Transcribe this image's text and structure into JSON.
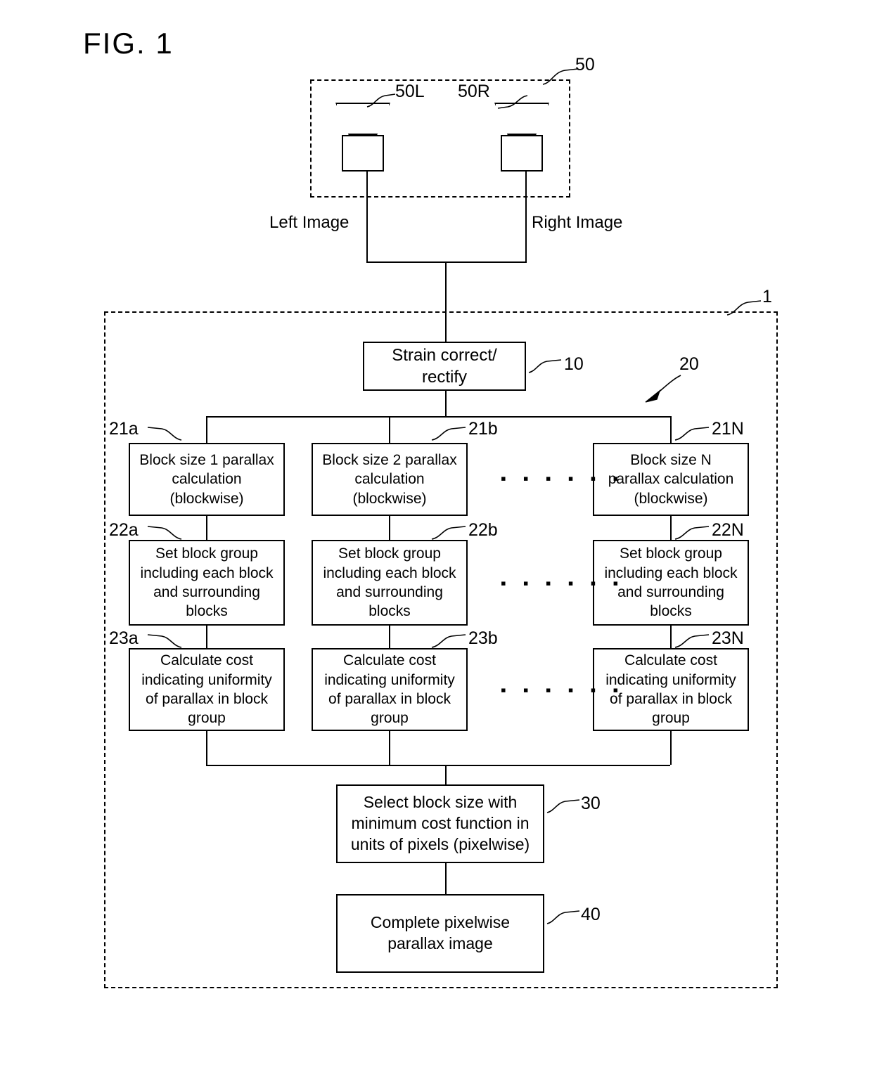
{
  "figure": {
    "title": "FIG. 1"
  },
  "camera_unit": {
    "ref": "50",
    "left_camera": {
      "ref": "50L",
      "icon": "camera-icon"
    },
    "right_camera": {
      "ref": "50R",
      "icon": "camera-icon"
    }
  },
  "signals": {
    "left_image": "Left Image",
    "right_image": "Right Image"
  },
  "device": {
    "ref": "1",
    "parallax_module_ref": "20"
  },
  "blocks": {
    "rectify": {
      "ref": "10",
      "lines": [
        "Strain correct/",
        "rectify"
      ]
    },
    "parallax_calc": [
      {
        "ref": "21a",
        "lines": [
          "Block size 1 parallax",
          "calculation",
          "(blockwise)"
        ]
      },
      {
        "ref": "21b",
        "lines": [
          "Block size 2 parallax",
          "calculation",
          "(blockwise)"
        ]
      },
      {
        "ref": "21N",
        "lines": [
          "Block size N",
          "parallax calculation",
          "(blockwise)"
        ]
      }
    ],
    "set_block_group": [
      {
        "ref": "22a",
        "lines": [
          "Set block group",
          "including each block",
          "and surrounding",
          "blocks"
        ]
      },
      {
        "ref": "22b",
        "lines": [
          "Set block group",
          "including each block",
          "and surrounding",
          "blocks"
        ]
      },
      {
        "ref": "22N",
        "lines": [
          "Set block group",
          "including each block",
          "and surrounding",
          "blocks"
        ]
      }
    ],
    "calculate_cost": [
      {
        "ref": "23a",
        "lines": [
          "Calculate cost",
          "indicating uniformity",
          "of parallax in block",
          "group"
        ]
      },
      {
        "ref": "23b",
        "lines": [
          "Calculate cost",
          "indicating uniformity",
          "of parallax in block",
          "group"
        ]
      },
      {
        "ref": "23N",
        "lines": [
          "Calculate cost",
          "indicating uniformity",
          "of parallax in block",
          "group"
        ]
      }
    ],
    "select_block_size": {
      "ref": "30",
      "lines": [
        "Select block size with",
        "minimum cost function in",
        "units of pixels (pixelwise)"
      ]
    },
    "complete_image": {
      "ref": "40",
      "lines": [
        "Complete pixelwise",
        "parallax image"
      ]
    }
  },
  "ellipsis": {
    "row1": "▪ ▪ ▪ ▪ ▪ ▪",
    "row2": "▪ ▪ ▪ ▪ ▪ ▪",
    "row3": "▪ ▪ ▪ ▪ ▪ ▪"
  },
  "colors": {
    "line": "#000000",
    "background": "#ffffff"
  }
}
